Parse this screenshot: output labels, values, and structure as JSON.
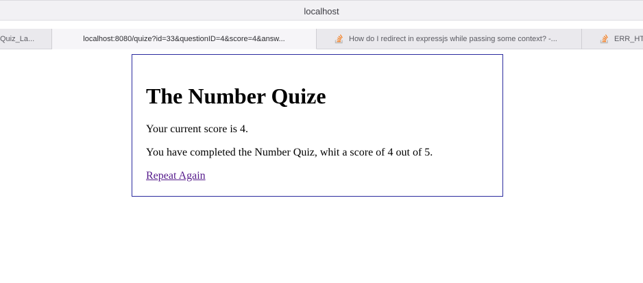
{
  "browser": {
    "address_bar": "localhost",
    "tabs": [
      {
        "label": "Quiz_La...",
        "icon": "generic-tab-icon",
        "active": false
      },
      {
        "label": "localhost:8080/quize?id=33&questionID=4&score=4&answ...",
        "icon": "",
        "active": true
      },
      {
        "label": "How do I redirect in expressjs while passing some context? -...",
        "icon": "stackoverflow-icon",
        "active": false
      },
      {
        "label": "ERR_HT",
        "icon": "stackoverflow-icon",
        "active": false
      }
    ],
    "colors": {
      "stackoverflow_orange": "#f48024",
      "stackoverflow_gray": "#bcbbbb"
    }
  },
  "page": {
    "title": "The Number Quize",
    "score_text": "Your current score is 4.",
    "completed_text": "You have completed the Number Quiz, whit a score of 4 out of 5.",
    "repeat_link": "Repeat Again",
    "colors": {
      "box_border": "#2a2a9e",
      "visited_link": "#551a8b"
    }
  }
}
